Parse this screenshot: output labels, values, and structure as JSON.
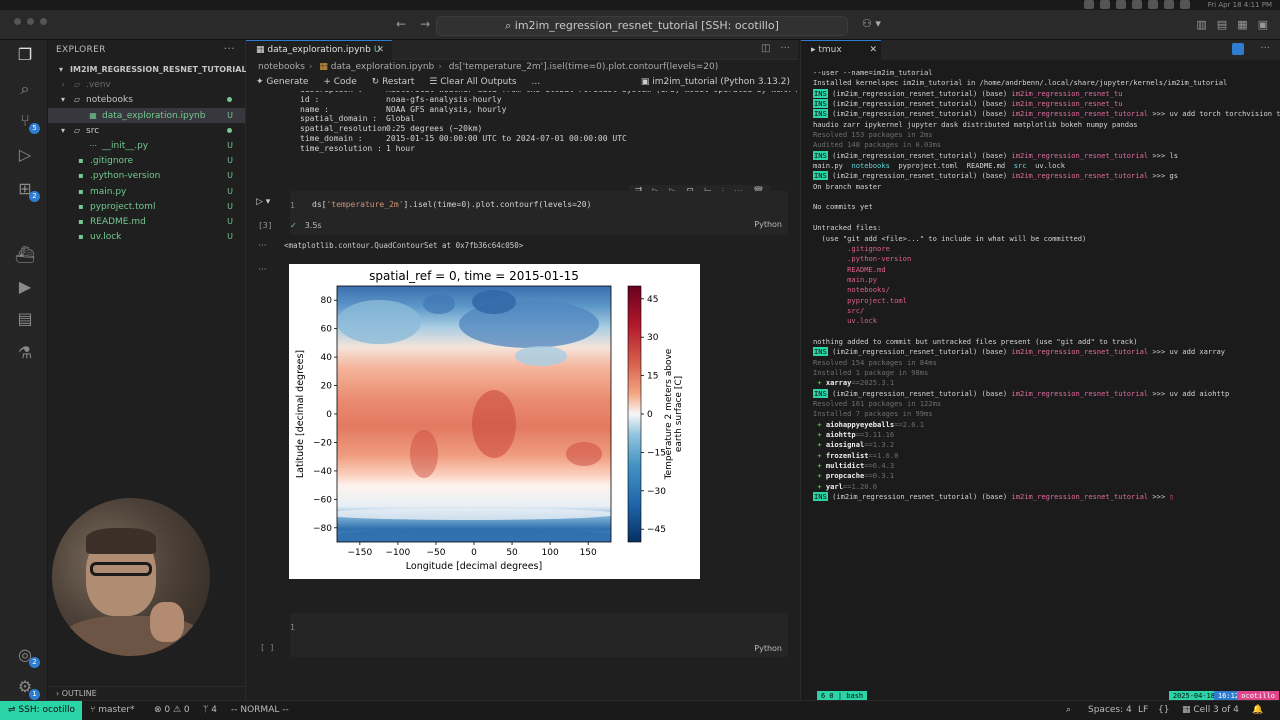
{
  "window": {
    "command_center": "im2im_regression_resnet_tutorial [SSH: ocotillo]",
    "clock": "Fri Apr 18 4:11 PM"
  },
  "sidebar": {
    "title": "EXPLORER",
    "root": "IM2IM_REGRESSION_RESNET_TUTORIAL [SSH:...",
    "items": [
      {
        "label": ".venv",
        "status": "",
        "kind": "folder-dim"
      },
      {
        "label": "notebooks",
        "status": "",
        "kind": "folder-open"
      },
      {
        "label": "data_exploration.ipynb",
        "status": "U",
        "kind": "file-selected"
      },
      {
        "label": "src",
        "status": "",
        "kind": "folder-open"
      },
      {
        "label": "__init__.py",
        "status": "U",
        "kind": "file-child"
      },
      {
        "label": ".gitignore",
        "status": "U",
        "kind": "file"
      },
      {
        "label": ".python-version",
        "status": "U",
        "kind": "file"
      },
      {
        "label": "main.py",
        "status": "U",
        "kind": "file"
      },
      {
        "label": "pyproject.toml",
        "status": "U",
        "kind": "file"
      },
      {
        "label": "README.md",
        "status": "U",
        "kind": "file"
      },
      {
        "label": "uv.lock",
        "status": "U",
        "kind": "file"
      }
    ],
    "outline": "OUTLINE"
  },
  "editor": {
    "tab_label": "data_exploration.ipynb",
    "tab_status": "U",
    "breadcrumb": [
      "notebooks",
      "data_exploration.ipynb",
      "ds['temperature_2m'].isel(time=0).plot.contourf(levels=20)"
    ],
    "toolbar": {
      "generate": "Generate",
      "code": "+ Code",
      "restart": "Restart",
      "clear": "Clear All Outputs",
      "more": "...",
      "kernel": "im2im_tutorial (Python 3.13.2)"
    },
    "meta": [
      {
        "k": "description :",
        "v": "Historical weather data from the Global Forecast System (GFS) model operated by NOAA NCEP."
      },
      {
        "k": "id :",
        "v": "noaa-gfs-analysis-hourly"
      },
      {
        "k": "name :",
        "v": "NOAA GFS analysis, hourly"
      },
      {
        "k": "spatial_domain :",
        "v": "Global"
      },
      {
        "k": "spatial_resolution :",
        "v": "0.25 degrees (~20km)"
      },
      {
        "k": "time_domain :",
        "v": "2015-01-15 00:00:00 UTC to 2024-07-01 00:00:00 UTC"
      },
      {
        "k": "time_resolution :",
        "v": "1 hour"
      }
    ],
    "cell": {
      "line_no": "1",
      "code": "ds['temperature_2m'].isel(time=0).plot.contourf(levels=20)",
      "lang": "Python",
      "exec_count": "[3]",
      "exec_time": "3.5s",
      "output_text": "<matplotlib.contour.QuadContourSet at 0x7fb36c64c050>"
    },
    "cell2": {
      "line_no": "1",
      "lang": "Python",
      "exec_count": "[ ]"
    }
  },
  "chart_data": {
    "type": "heatmap",
    "title": "spatial_ref = 0, time = 2015-01-15",
    "xlabel": "Longitude [decimal degrees]",
    "ylabel": "Latitude [decimal degrees]",
    "colorbar_label": "Temperature 2 meters above earth surface [C]",
    "xticks": [
      -150,
      -100,
      -50,
      0,
      50,
      100,
      150
    ],
    "yticks": [
      80,
      60,
      40,
      20,
      0,
      -20,
      -40,
      -60,
      -80
    ],
    "cbar_ticks": [
      45,
      30,
      15,
      0,
      -15,
      -30,
      -45
    ],
    "xlim": [
      -180,
      180
    ],
    "ylim": [
      -90,
      90
    ],
    "clim": [
      -50,
      50
    ],
    "levels": 20,
    "colormap": "RdBu_r"
  },
  "terminal": {
    "tab_label": "tmux",
    "lines": [
      [
        [
          "--user --name=im2im_tutorial",
          ""
        ]
      ],
      [
        [
          "Installed kernelspec im2im_tutorial in /home/andrbenn/.local/share/jupyter/kernels/im2im_tutorial",
          ""
        ]
      ],
      [
        [
          "INS",
          "ins"
        ],
        [
          " (im2im_regression_resnet_tutorial) (base) ",
          ""
        ],
        [
          "im2im_regression_resnet_tu",
          "pk"
        ]
      ],
      [
        [
          "INS",
          "ins"
        ],
        [
          " (im2im_regression_resnet_tutorial) (base) ",
          ""
        ],
        [
          "im2im_regression_resnet_tu",
          "pk"
        ]
      ],
      [
        [
          "INS",
          "ins"
        ],
        [
          " (im2im_regression_resnet_tutorial) (base) ",
          ""
        ],
        [
          "im2im_regression_resnet_tutorial",
          "pk"
        ],
        [
          " >>> uv add torch torchvision torc",
          ""
        ]
      ],
      [
        [
          "haudio zarr ipykernel jupyter dask distributed matplotlib bokeh numpy pandas",
          ""
        ]
      ],
      [
        [
          "Resolved 153 packages in 2ms",
          "gr"
        ]
      ],
      [
        [
          "Audited 148 packages in 0.03ms",
          "gr"
        ]
      ],
      [
        [
          "INS",
          "ins"
        ],
        [
          " (im2im_regression_resnet_tutorial) (base) ",
          ""
        ],
        [
          "im2im_regression_resnet_tutorial",
          "pk"
        ],
        [
          " >>> ls",
          ""
        ]
      ],
      [
        [
          "main.py  ",
          ""
        ],
        [
          "notebooks",
          "cy"
        ],
        [
          "  pyproject.toml  README.md  ",
          ""
        ],
        [
          "src",
          "cy"
        ],
        [
          "  uv.lock",
          ""
        ]
      ],
      [
        [
          "INS",
          "ins"
        ],
        [
          " (im2im_regression_resnet_tutorial) (base) ",
          ""
        ],
        [
          "im2im_regression_resnet_tutorial",
          "pk"
        ],
        [
          " >>> gs",
          ""
        ]
      ],
      [
        [
          "On branch master",
          ""
        ]
      ],
      [
        [
          "",
          ""
        ]
      ],
      [
        [
          "No commits yet",
          ""
        ]
      ],
      [
        [
          "",
          ""
        ]
      ],
      [
        [
          "Untracked files:",
          ""
        ]
      ],
      [
        [
          "  (use \"git add <file>...\" to include in what will be committed)",
          ""
        ]
      ],
      [
        [
          "        .gitignore",
          "rd"
        ]
      ],
      [
        [
          "        .python-version",
          "rd"
        ]
      ],
      [
        [
          "        README.md",
          "rd"
        ]
      ],
      [
        [
          "        main.py",
          "rd"
        ]
      ],
      [
        [
          "        notebooks/",
          "rd"
        ]
      ],
      [
        [
          "        pyproject.toml",
          "rd"
        ]
      ],
      [
        [
          "        src/",
          "rd"
        ]
      ],
      [
        [
          "        uv.lock",
          "rd"
        ]
      ],
      [
        [
          "",
          ""
        ]
      ],
      [
        [
          "nothing added to commit but untracked files present (use \"git add\" to track)",
          ""
        ]
      ],
      [
        [
          "INS",
          "ins"
        ],
        [
          " (im2im_regression_resnet_tutorial) (base) ",
          ""
        ],
        [
          "im2im_regression_resnet_tutorial",
          "pk"
        ],
        [
          " >>> uv add xarray",
          ""
        ]
      ],
      [
        [
          "Resolved 154 packages in 84ms",
          "gr"
        ]
      ],
      [
        [
          "Installed 1 package in 98ms",
          "gr"
        ]
      ],
      [
        [
          " + ",
          "gn"
        ],
        [
          "xarray",
          "wb"
        ],
        [
          "==2025.3.1",
          "gr"
        ]
      ],
      [
        [
          "INS",
          "ins"
        ],
        [
          " (im2im_regression_resnet_tutorial) (base) ",
          ""
        ],
        [
          "im2im_regression_resnet_tutorial",
          "pk"
        ],
        [
          " >>> uv add aiohttp",
          ""
        ]
      ],
      [
        [
          "Resolved 161 packages in 122ms",
          "gr"
        ]
      ],
      [
        [
          "Installed 7 packages in 99ms",
          "gr"
        ]
      ],
      [
        [
          " + ",
          "gn"
        ],
        [
          "aiohappyeyeballs",
          "wb"
        ],
        [
          "==2.6.1",
          "gr"
        ]
      ],
      [
        [
          " + ",
          "gn"
        ],
        [
          "aiohttp",
          "wb"
        ],
        [
          "==3.11.16",
          "gr"
        ]
      ],
      [
        [
          " + ",
          "gn"
        ],
        [
          "aiosignal",
          "wb"
        ],
        [
          "==1.3.2",
          "gr"
        ]
      ],
      [
        [
          " + ",
          "gn"
        ],
        [
          "frozenlist",
          "wb"
        ],
        [
          "==1.6.0",
          "gr"
        ]
      ],
      [
        [
          " + ",
          "gn"
        ],
        [
          "multidict",
          "wb"
        ],
        [
          "==6.4.3",
          "gr"
        ]
      ],
      [
        [
          " + ",
          "gn"
        ],
        [
          "propcache",
          "wb"
        ],
        [
          "==0.3.1",
          "gr"
        ]
      ],
      [
        [
          " + ",
          "gn"
        ],
        [
          "yarl",
          "wb"
        ],
        [
          "==1.20.0",
          "gr"
        ]
      ],
      [
        [
          "INS",
          "ins"
        ],
        [
          " (im2im_regression_resnet_tutorial) (base) ",
          ""
        ],
        [
          "im2im_regression_resnet_tutorial",
          "pk"
        ],
        [
          " >>> ",
          ""
        ],
        [
          "▯",
          "rd"
        ]
      ]
    ],
    "tmux_left": "6  0 | bash",
    "tmux_date": "2025-04-18",
    "tmux_time": "16:12",
    "tmux_host": "ocotillo"
  },
  "statusbar": {
    "remote": "SSH: ocotillo",
    "branch": "master*",
    "problems": "⊗ 0 ⚠ 0",
    "ports": "4",
    "mode": "-- NORMAL --",
    "spaces": "Spaces: 4",
    "eol": "LF",
    "cell": "Cell 3 of 4"
  }
}
